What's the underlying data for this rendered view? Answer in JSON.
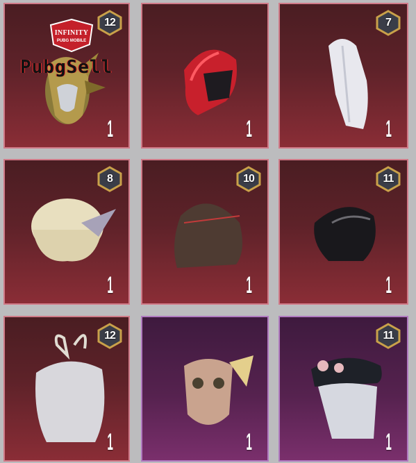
{
  "colors": {
    "card_red_border": "#d07a88",
    "card_purple_border": "#b07ac0",
    "badge_gold": "#c9a14a",
    "background": "#bcbcbe"
  },
  "watermark": {
    "title": "INFINITY",
    "subtitle": "PUBG MOBILE",
    "brand": "PubgSell"
  },
  "items": [
    {
      "rarity": "red",
      "level": "12",
      "count": "1",
      "icon": "golden-masked-helmet-icon"
    },
    {
      "rarity": "red",
      "level": "",
      "count": "1",
      "icon": "red-helmet-icon"
    },
    {
      "rarity": "red",
      "level": "7",
      "count": "1",
      "icon": "white-hair-icon"
    },
    {
      "rarity": "red",
      "level": "8",
      "count": "1",
      "icon": "blonde-hair-winged-icon"
    },
    {
      "rarity": "red",
      "level": "10",
      "count": "1",
      "icon": "brown-wavy-hair-icon"
    },
    {
      "rarity": "red",
      "level": "11",
      "count": "1",
      "icon": "black-hair-icon"
    },
    {
      "rarity": "red",
      "level": "12",
      "count": "1",
      "icon": "silver-bunny-hair-icon"
    },
    {
      "rarity": "purple",
      "level": "",
      "count": "1",
      "icon": "animal-mask-hat-icon"
    },
    {
      "rarity": "purple",
      "level": "11",
      "count": "1",
      "icon": "beret-silver-hair-icon"
    }
  ]
}
